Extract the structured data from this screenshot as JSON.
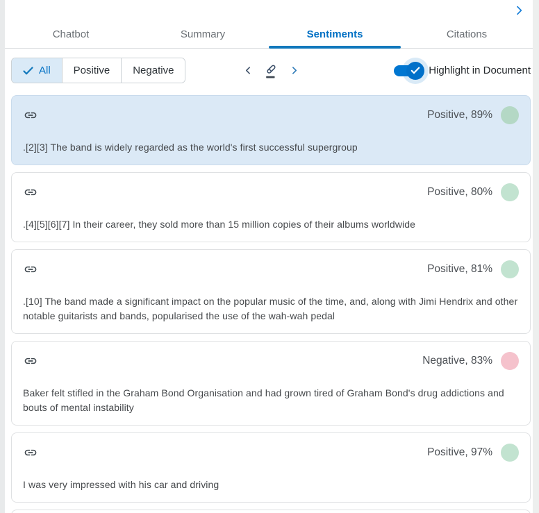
{
  "top_bar": {
    "expand_icon": "chevron-right"
  },
  "tabs": {
    "items": [
      {
        "label": "Chatbot",
        "state": ""
      },
      {
        "label": "Summary",
        "state": ""
      },
      {
        "label": "Sentiments",
        "state": "active"
      },
      {
        "label": "Citations",
        "state": ""
      }
    ]
  },
  "filterbar": {
    "all_label": "All",
    "positive_label": "Positive",
    "negative_label": "Negative",
    "selected_filter": "All",
    "prev_icon": "chevron-left",
    "highlighter_icon": "highlighter-pen",
    "next_icon": "chevron-right",
    "toggle_label": "Highlight in Document",
    "toggle_state": "on"
  },
  "icons": {
    "link": "link",
    "check": "checkmark"
  },
  "colors": {
    "accent_blue": "#0070c4",
    "selected_card_bg": "#dbe9f6",
    "positive_dot": "#c2e3d0",
    "negative_dot": "#f5c2cc"
  },
  "cards": [
    {
      "sentiment_label": "Positive, 89%",
      "polarity": "positive",
      "state": "selected",
      "text": ".[2][3] The band is widely regarded as the world's first successful supergroup"
    },
    {
      "sentiment_label": "Positive, 80%",
      "polarity": "positive",
      "state": "",
      "text": ".[4][5][6][7] In their career, they sold more than 15 million copies of their albums worldwide"
    },
    {
      "sentiment_label": "Positive, 81%",
      "polarity": "positive",
      "state": "",
      "text": ".[10] The band made a significant impact on the popular music of the time, and, along with Jimi Hendrix and other notable guitarists and bands, popularised the use of the wah-wah pedal"
    },
    {
      "sentiment_label": "Negative, 83%",
      "polarity": "negative",
      "state": "",
      "text": "Baker felt stifled in the Graham Bond Organisation and had grown tired of Graham Bond's drug addictions and bouts of mental instability"
    },
    {
      "sentiment_label": "Positive, 97%",
      "polarity": "positive",
      "state": "",
      "text": "I was very impressed with his car and driving"
    }
  ]
}
